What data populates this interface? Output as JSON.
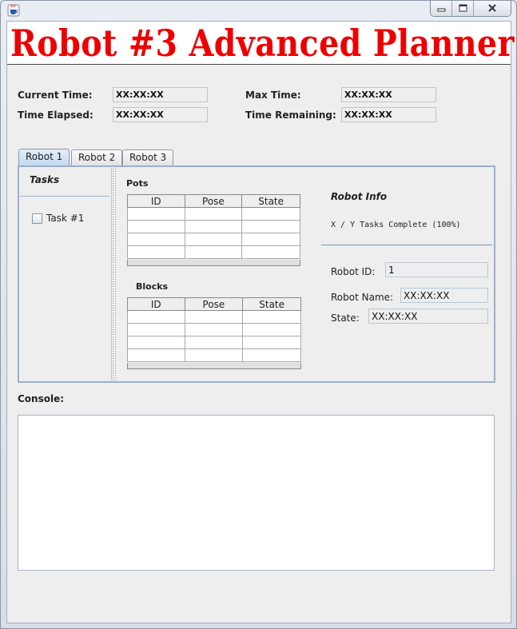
{
  "window": {
    "icon": "java-cup-icon",
    "controls": [
      "minimize-icon",
      "maximize-icon",
      "close-icon"
    ]
  },
  "banner": {
    "title": "Robot #3 Advanced Planner",
    "color": "#ee0000"
  },
  "timing": {
    "current_time_label": "Current Time:",
    "current_time_value": "XX:XX:XX",
    "time_elapsed_label": "Time Elapsed:",
    "time_elapsed_value": "XX:XX:XX",
    "max_time_label": "Max Time:",
    "max_time_value": "XX:XX:XX",
    "time_remaining_label": "Time Remaining:",
    "time_remaining_value": "XX:XX:XX"
  },
  "tabs": [
    {
      "label": "Robot 1",
      "active": true
    },
    {
      "label": "Robot 2",
      "active": false
    },
    {
      "label": "Robot 3",
      "active": false
    }
  ],
  "tasks": {
    "title": "Tasks",
    "items": [
      {
        "label": "Task #1",
        "checked": false
      }
    ]
  },
  "pots": {
    "title": "Pots",
    "columns": [
      "ID",
      "Pose",
      "State"
    ],
    "rows": [
      [
        "",
        "",
        ""
      ],
      [
        "",
        "",
        ""
      ],
      [
        "",
        "",
        ""
      ],
      [
        "",
        "",
        ""
      ]
    ]
  },
  "blocks": {
    "title": "Blocks",
    "columns": [
      "ID",
      "Pose",
      "State"
    ],
    "rows": [
      [
        "",
        "",
        ""
      ],
      [
        "",
        "",
        ""
      ],
      [
        "",
        "",
        ""
      ],
      [
        "",
        "",
        ""
      ]
    ]
  },
  "robot_info": {
    "title": "Robot Info",
    "progress": "X / Y Tasks Complete (100%)",
    "id_label": "Robot ID:",
    "id_value": "1",
    "name_label": "Robot Name:",
    "name_value": "XX:XX:XX",
    "state_label": "State:",
    "state_value": "XX:XX:XX"
  },
  "console": {
    "label": "Console:",
    "content": ""
  }
}
